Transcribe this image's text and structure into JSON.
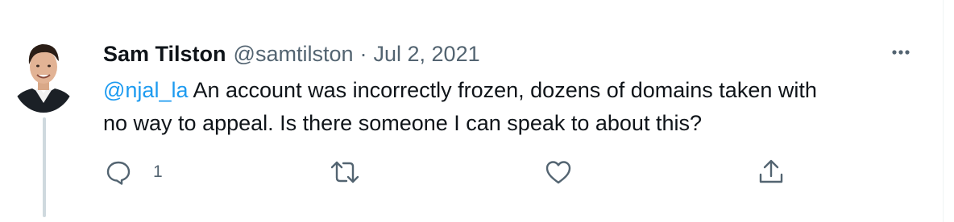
{
  "tweet": {
    "display_name": "Sam Tilston",
    "handle": "@samtilston",
    "separator": "·",
    "date": "Jul 2, 2021",
    "mention": "@njal_la",
    "text_line1": " An account was incorrectly frozen, dozens of domains taken with",
    "text_line2": "no way to appeal. Is there someone I can speak to about this?"
  },
  "actions": {
    "reply_count": "1"
  },
  "icons": {
    "avatar": "user-avatar-photo",
    "more": "more-dots-icon",
    "reply": "reply-icon",
    "retweet": "retweet-icon",
    "like": "heart-icon",
    "share": "share-icon"
  },
  "colors": {
    "text": "#0f1419",
    "secondary": "#536471",
    "link": "#1d9bf0",
    "thread_line": "#cfd9de"
  }
}
